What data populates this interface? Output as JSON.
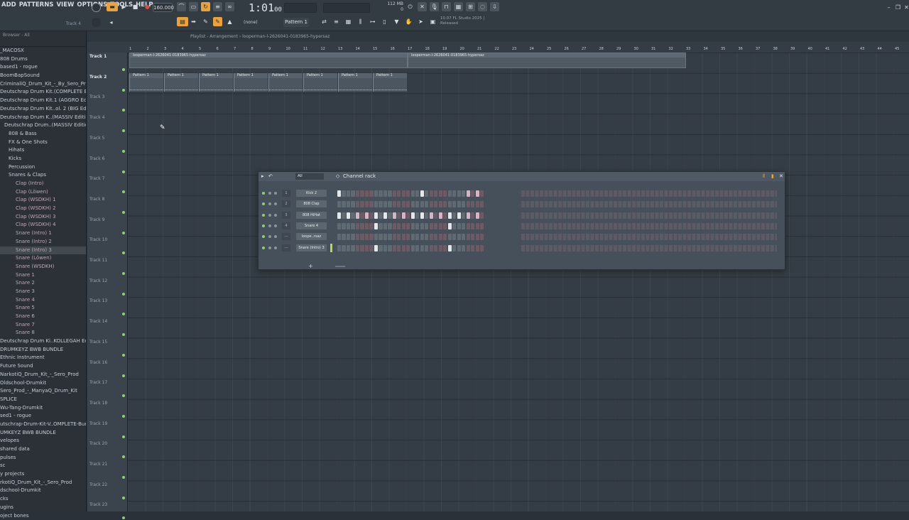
{
  "menu": [
    "ADD",
    "PATTERNS",
    "VIEW",
    "OPTIONS",
    "TOOLS",
    "HELP"
  ],
  "toolbar": {
    "tempo": "160.000",
    "time": "1:01",
    "time_sub": "00",
    "pattern": "Pattern 1",
    "snap": "(none)",
    "cpu_line1": "112 MB",
    "cpu_line2": "0",
    "cpu_top": "1",
    "news_line1": "10.07  FL Studio 2025 |",
    "news_line2": "Released",
    "track_label": "Track 4"
  },
  "browser": {
    "title": "Browser - All",
    "items": [
      {
        "label": "_MACOSX",
        "type": "folder"
      },
      {
        "label": "808 Drums",
        "type": "folder"
      },
      {
        "label": "based1 - rogue",
        "type": "folder"
      },
      {
        "label": "BoomBapSound",
        "type": "folder"
      },
      {
        "label": "CriminaliQ_Drum_Kit_-_By_Sero_Prod",
        "type": "folder"
      },
      {
        "label": "Deutschrap Drum Kit.(COMPLETE Bundle)",
        "type": "folder"
      },
      {
        "label": "Deutschrap Drum Kit.1 (AGGRO Edition)",
        "type": "folder"
      },
      {
        "label": "Deutschrap Drum Kit..ol. 2 (BIG Edition)",
        "type": "folder"
      },
      {
        "label": "Deutschrap Drum K..(MASSIV Edition)",
        "type": "folder"
      },
      {
        "label": "Deutschrap Drum..(MASSIV Edition)",
        "type": "folder"
      },
      {
        "label": "808 & Bass",
        "type": "folder"
      },
      {
        "label": "FX & One Shots",
        "type": "folder"
      },
      {
        "label": "Hihats",
        "type": "folder"
      },
      {
        "label": "Kicks",
        "type": "folder"
      },
      {
        "label": "Percussion",
        "type": "folder"
      },
      {
        "label": "Snares & Claps",
        "type": "folder"
      },
      {
        "label": "Clap (Intro)",
        "type": "sample"
      },
      {
        "label": "Clap (Löwen)",
        "type": "sample"
      },
      {
        "label": "Clap (WSDKH) 1",
        "type": "sample"
      },
      {
        "label": "Clap (WSDKH) 2",
        "type": "sample"
      },
      {
        "label": "Clap (WSDKH) 3",
        "type": "sample"
      },
      {
        "label": "Clap (WSDKH) 4",
        "type": "sample"
      },
      {
        "label": "Snare (Intro) 1",
        "type": "sample"
      },
      {
        "label": "Snare (Intro) 2",
        "type": "sample"
      },
      {
        "label": "Snare (Intro) 3",
        "type": "sample"
      },
      {
        "label": "Snare (Löwen)",
        "type": "sample"
      },
      {
        "label": "Snare (WSDKH)",
        "type": "sample"
      },
      {
        "label": "Snare 1",
        "type": "sample"
      },
      {
        "label": "Snare 2",
        "type": "sample"
      },
      {
        "label": "Snare 3",
        "type": "sample"
      },
      {
        "label": "Snare 4",
        "type": "sample"
      },
      {
        "label": "Snare 5",
        "type": "sample"
      },
      {
        "label": "Snare 6",
        "type": "sample"
      },
      {
        "label": "Snare 7",
        "type": "sample"
      },
      {
        "label": "Snare 8",
        "type": "sample"
      },
      {
        "label": "Deutschrap Drum Ki..KOLLEGAH Edition)",
        "type": "folder"
      },
      {
        "label": "DRUMKEYZ BWB BUNDLE",
        "type": "folder"
      },
      {
        "label": "Ethnic Instrument",
        "type": "folder"
      },
      {
        "label": "Future Sound",
        "type": "folder"
      },
      {
        "label": "NarkotiQ_Drum_Kit_-_Sero_Prod",
        "type": "folder"
      },
      {
        "label": "Oldschool-Drumkit",
        "type": "folder"
      },
      {
        "label": "Sero_Prod_-_ManyaQ_Drum_Kit",
        "type": "folder"
      },
      {
        "label": "SPLICE",
        "type": "folder"
      },
      {
        "label": "Wu-Tang-Drumkit",
        "type": "folder"
      },
      {
        "label": "sed1 - rogue",
        "type": "folder"
      },
      {
        "label": "utschrap-Drum-Kit-V..OMPLETE-Bundle-aa7jck",
        "type": "folder"
      },
      {
        "label": "UMKEYZ BWB BUNDLE",
        "type": "folder"
      },
      {
        "label": "velopes",
        "type": "folder"
      },
      {
        "label": "shared data",
        "type": "folder"
      },
      {
        "label": "pulses",
        "type": "folder"
      },
      {
        "label": "sc",
        "type": "folder"
      },
      {
        "label": "y projects",
        "type": "folder"
      },
      {
        "label": "rkotiQ_Drum_Kit_-_Sero_Prod",
        "type": "folder"
      },
      {
        "label": "dschool-Drumkit",
        "type": "folder"
      },
      {
        "label": "cks",
        "type": "folder"
      },
      {
        "label": "ugins",
        "type": "folder"
      },
      {
        "label": "oject bones",
        "type": "folder"
      }
    ]
  },
  "playlist": {
    "title": "Playlist - Arrangement › looperman-l-2626041-0183965-hypersaz",
    "ruler": [
      "1",
      "2",
      "3",
      "4",
      "5",
      "6",
      "7",
      "8",
      "9",
      "10",
      "11",
      "12",
      "13",
      "14",
      "15",
      "16",
      "17",
      "18",
      "19",
      "20",
      "21",
      "22",
      "23",
      "24",
      "25",
      "26",
      "27",
      "28",
      "29",
      "30",
      "31",
      "32",
      "33",
      "34",
      "35",
      "36",
      "37",
      "38",
      "39",
      "40",
      "41",
      "42",
      "43",
      "44",
      "45"
    ],
    "tracks": [
      "Track 1",
      "Track 2",
      "Track 3",
      "Track 4",
      "Track 5",
      "Track 6",
      "Track 7",
      "Track 8",
      "Track 9",
      "Track 10",
      "Track 11",
      "Track 12",
      "Track 13",
      "Track 14",
      "Track 15",
      "Track 16",
      "Track 17",
      "Track 18",
      "Track 19",
      "Track 20",
      "Track 21",
      "Track 22",
      "Track 23"
    ],
    "audio_clip_1": "looperman-l-2626041-0183965-hypersaz",
    "audio_clip_2": "looperman-l-2626041-0183965-hypersaz",
    "pattern_clip": "Pattern 1"
  },
  "channel_rack": {
    "title": "Channel rack",
    "filter": "All",
    "channels": [
      {
        "num": "1",
        "name": "Kick 2",
        "steps": [
          1,
          0,
          0,
          0,
          0,
          0,
          0,
          0,
          0,
          0,
          0,
          0,
          0,
          0,
          0,
          0,
          0,
          0,
          1,
          0,
          0,
          0,
          0,
          0,
          0,
          0,
          0,
          0,
          1,
          0,
          1,
          0
        ]
      },
      {
        "num": "2",
        "name": "808 Clap",
        "steps": [
          0,
          0,
          0,
          0,
          0,
          0,
          0,
          0,
          0,
          0,
          0,
          0,
          0,
          0,
          0,
          0,
          0,
          0,
          0,
          0,
          0,
          0,
          0,
          0,
          0,
          0,
          0,
          0,
          0,
          0,
          0,
          0
        ]
      },
      {
        "num": "3",
        "name": "808 HiHat",
        "steps": [
          1,
          0,
          1,
          0,
          1,
          0,
          1,
          0,
          1,
          0,
          1,
          0,
          1,
          0,
          1,
          0,
          1,
          0,
          1,
          0,
          1,
          0,
          1,
          0,
          1,
          0,
          1,
          0,
          1,
          0,
          1,
          0
        ]
      },
      {
        "num": "4",
        "name": "Snare 4",
        "steps": [
          0,
          0,
          0,
          0,
          0,
          0,
          0,
          0,
          1,
          0,
          0,
          0,
          0,
          0,
          0,
          0,
          0,
          0,
          0,
          0,
          0,
          0,
          0,
          0,
          1,
          0,
          0,
          0,
          0,
          0,
          0,
          0
        ]
      },
      {
        "num": "---",
        "name": "loope..rsaz",
        "steps": [
          0,
          0,
          0,
          0,
          0,
          0,
          0,
          0,
          0,
          0,
          0,
          0,
          0,
          0,
          0,
          0,
          0,
          0,
          0,
          0,
          0,
          0,
          0,
          0,
          0,
          0,
          0,
          0,
          0,
          0,
          0,
          0
        ]
      },
      {
        "num": "---",
        "name": "Snare (Intro) 3",
        "steps": [
          0,
          0,
          0,
          0,
          0,
          0,
          0,
          0,
          1,
          0,
          0,
          0,
          0,
          0,
          0,
          0,
          0,
          0,
          0,
          0,
          0,
          0,
          0,
          0,
          1,
          0,
          0,
          0,
          0,
          0,
          0,
          0
        ]
      }
    ]
  }
}
